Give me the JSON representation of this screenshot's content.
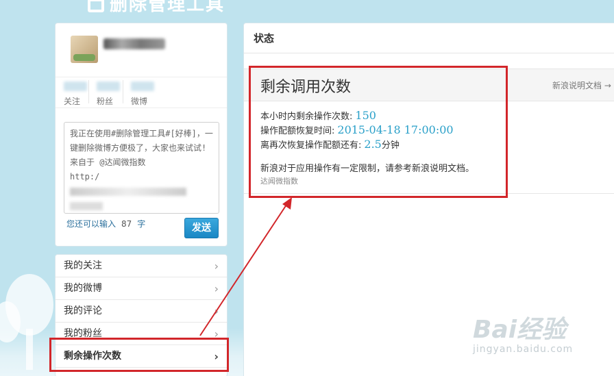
{
  "app": {
    "title": "删除管理工具"
  },
  "profile": {
    "stats": [
      {
        "label": "关注"
      },
      {
        "label": "粉丝"
      },
      {
        "label": "微博"
      }
    ],
    "share_text_1": "我正在使用#删除管理工具#[好棒]，一键删除微博方便极了，大家也来试试!来自于 @达闻微指数",
    "share_text_url_prefix": "http:/",
    "remain_prefix": "您还可以输入",
    "remain_count": "87",
    "remain_suffix": "字",
    "send_label": "发送"
  },
  "menu": {
    "items": [
      {
        "label": "我的关注"
      },
      {
        "label": "我的微博"
      },
      {
        "label": "我的评论"
      },
      {
        "label": "我的粉丝"
      },
      {
        "label": "剩余操作次数"
      }
    ],
    "active_index": 4
  },
  "main": {
    "header": "状态",
    "section_title": "剩余调用次数",
    "doc_link": "新浪说明文档 →",
    "lines": {
      "hour_label": "本小时内剩余操作次数:",
      "hour_value": "150",
      "reset_label": "操作配额恢复时间:",
      "reset_value": "2015-04-18 17:00:00",
      "wait_label": "离再次恢复操作配额还有:",
      "wait_value": "2.5",
      "wait_unit": "分钟"
    },
    "notice": "新浪对于应用操作有一定限制，请参考新浪说明文档。",
    "source": "达闻微指数"
  },
  "watermark": {
    "main": "Bai经验",
    "sub": "jingyan.baidu.com"
  },
  "colors": {
    "accent": "#2aa0c9",
    "highlight": "#d2262a",
    "button": "#1a87c4",
    "background": "#bfe3ee"
  }
}
